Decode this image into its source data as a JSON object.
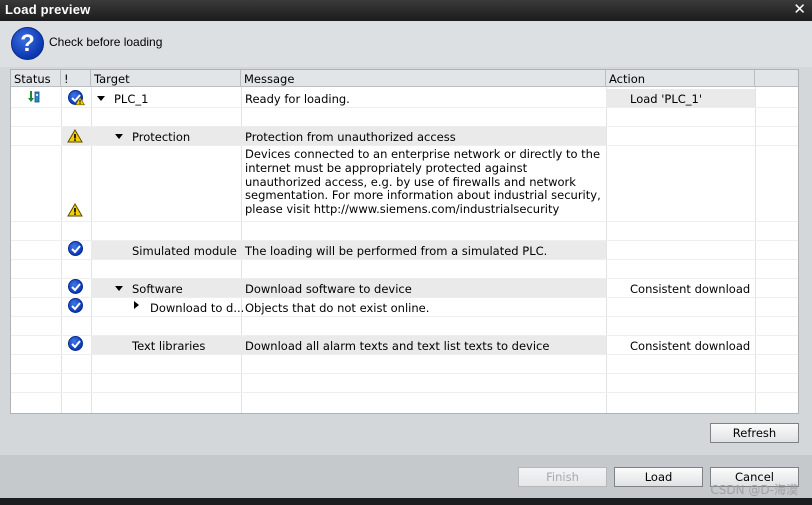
{
  "window": {
    "title": "Load preview",
    "close_glyph": "✕"
  },
  "header": {
    "subtitle": "Check before loading",
    "icon": "question-icon"
  },
  "columns": {
    "status": "Status",
    "flag": "!",
    "target": "Target",
    "message": "Message",
    "action": "Action"
  },
  "rows": [
    {
      "target": "PLC_1",
      "message": "Ready for loading.",
      "action": "Load 'PLC_1'"
    },
    {
      "target": "Protection",
      "message": "Protection from unauthorized access"
    },
    {
      "message": "Devices connected to an enterprise network or directly to the internet must be appropriately protected against unauthorized access, e.g. by use of firewalls and network segmentation. For more information about industrial security, please visit http://www.siemens.com/industrialsecurity"
    },
    {
      "target": "Simulated module",
      "message": "The loading will be performed from a simulated PLC."
    },
    {
      "target": "Software",
      "message": "Download software to device",
      "action": "Consistent download"
    },
    {
      "target": "Download to d...",
      "message": "Objects that do not exist online."
    },
    {
      "target": "Text libraries",
      "message": "Download all alarm texts and text list texts to device",
      "action": "Consistent download"
    }
  ],
  "buttons": {
    "refresh": "Refresh",
    "finish": "Finish",
    "load": "Load",
    "cancel": "Cancel"
  },
  "watermark": "CSDN @D-海漠",
  "colors": {
    "title_bg": "#1c1c1c",
    "check_blue": "#0c38b8",
    "warn_yellow": "#f5d000",
    "grid_bg": "#ffffff",
    "row_highlight": "#eaeaea"
  }
}
